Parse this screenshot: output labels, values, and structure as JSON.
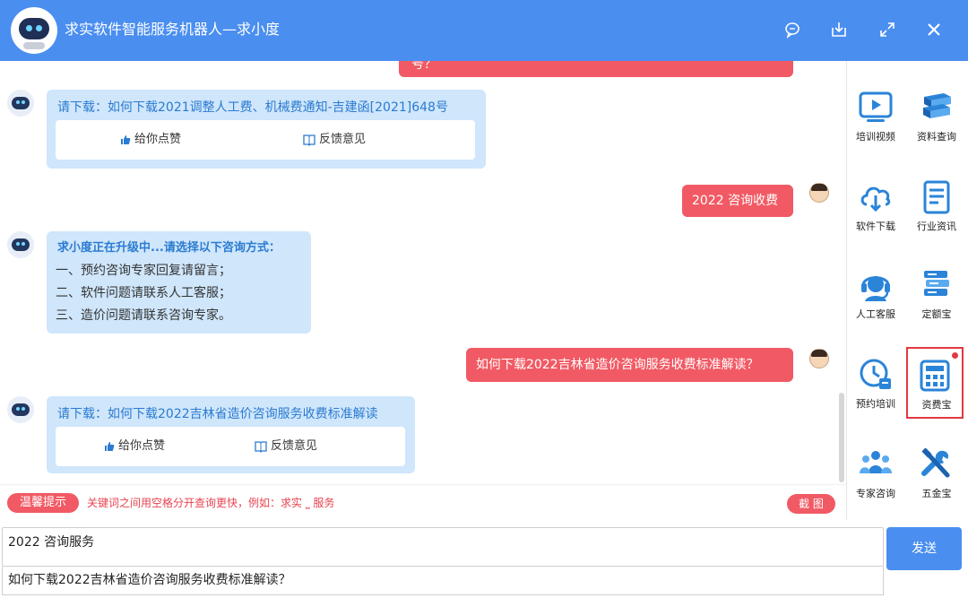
{
  "window": {
    "title": "求实软件智能服务机器人—求小度"
  },
  "chat": {
    "partial_user_message": "号？",
    "bot_msg_1": {
      "text": "请下载：如何下载2021调整人工费、机械费通知-吉建函[2021]648号",
      "like_label": "给你点赞",
      "feedback_label": "反馈意见"
    },
    "user_msg_1": "2022 咨询收费",
    "bot_msg_2": {
      "heading": "求小度正在升级中...请选择以下咨询方式：",
      "lines": [
        "一、预约咨询专家回复请留言；",
        "二、软件问题请联系人工客服；",
        "三、造价问题请联系咨询专家。"
      ]
    },
    "user_msg_2": "如何下载2022吉林省造价咨询服务收费标准解读？",
    "bot_msg_3": {
      "text": "请下载：如何下载2022吉林省造价咨询服务收费标准解读",
      "like_label": "给你点赞",
      "feedback_label": "反馈意见"
    }
  },
  "tipbar": {
    "badge": "温馨提示",
    "text": "关键词之间用空格分开查询更快，例如：求实 ⎵ 服务",
    "screenshot_label": "截 图"
  },
  "sidebar": {
    "items": [
      {
        "label": "培训视频",
        "icon": "video-play-icon"
      },
      {
        "label": "资料查询",
        "icon": "books-icon"
      },
      {
        "label": "软件下载",
        "icon": "cloud-download-icon"
      },
      {
        "label": "行业资讯",
        "icon": "document-icon"
      },
      {
        "label": "人工客服",
        "icon": "headset-icon"
      },
      {
        "label": "定额宝",
        "icon": "database-stack-icon"
      },
      {
        "label": "预约培训",
        "icon": "clock-calendar-icon"
      },
      {
        "label": "资费宝",
        "icon": "calculator-icon"
      },
      {
        "label": "专家咨询",
        "icon": "people-group-icon"
      },
      {
        "label": "五金宝",
        "icon": "tools-icon"
      }
    ]
  },
  "input": {
    "value": "2022 咨询服务",
    "suggestion": "如何下载2022吉林省造价咨询服务收费标准解读？",
    "send_label": "发送"
  },
  "colors": {
    "brand_blue": "#4a8ef0",
    "user_bubble": "#f15a64",
    "bot_bubble": "#cfe6fb"
  }
}
